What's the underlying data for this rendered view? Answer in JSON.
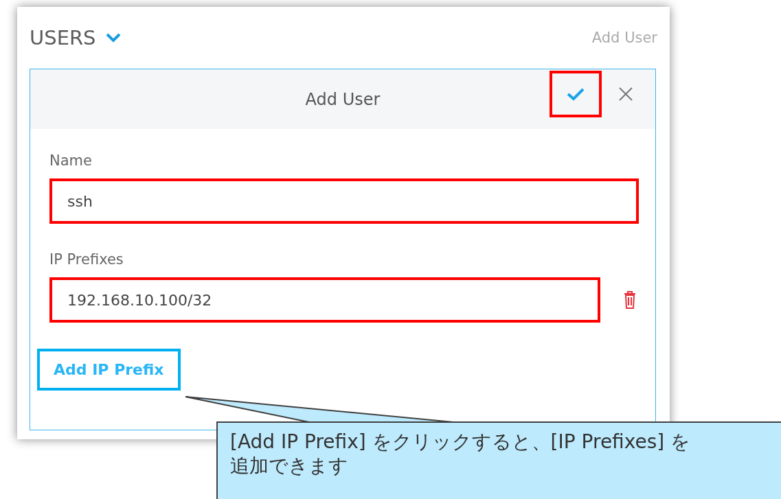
{
  "panel": {
    "title": "USERS",
    "add_link": "Add User"
  },
  "dialog": {
    "title": "Add User",
    "confirm": {
      "highlighted": true
    }
  },
  "fields": [
    {
      "label": "Name",
      "value": "ssh",
      "highlighted": true,
      "removable": false
    },
    {
      "label": "IP Prefixes",
      "value": "192.168.10.100/32",
      "highlighted": true,
      "removable": true
    }
  ],
  "add_prefix": {
    "label": "Add IP Prefix",
    "highlighted": true
  },
  "callout": {
    "lines": [
      "[Add IP Prefix] をクリックすると、[IP Prefixes] を",
      "追加できます"
    ]
  }
}
